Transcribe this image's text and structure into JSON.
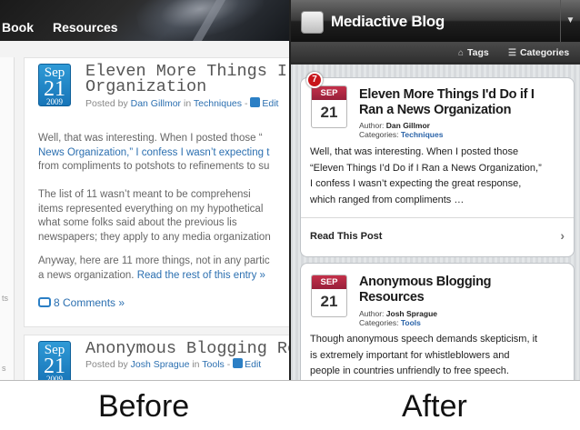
{
  "before": {
    "nav": [
      "Book",
      "Resources"
    ],
    "left_strip": [
      "ts",
      "s"
    ],
    "posts": [
      {
        "date": {
          "month": "Sep",
          "day": "21",
          "year": "2009"
        },
        "title_lines": [
          "Eleven More Things I’d Do",
          "Organization"
        ],
        "meta": {
          "prefix": "Posted by",
          "author": "Dan Gillmor",
          "in": "in",
          "category": "Techniques",
          "sep": "-",
          "edit": "Edit"
        },
        "paragraphs": [
          [
            "Well, that was interesting. When I posted those “",
            "News Organization,” I confess I wasn’t expecting t",
            "from compliments to potshots to refinements to su"
          ],
          [
            "The list of 11 wasn’t meant to be comprehensi",
            "items represented everything on my hypothetical",
            "what some folks said about the previous lis",
            "newspapers; they apply to any media organization"
          ],
          [
            "Anyway, here are 11 more things, not in any partic"
          ]
        ],
        "last_line": {
          "text": "a news organization.",
          "link": "Read the rest of this entry »"
        },
        "comments": "8 Comments »"
      },
      {
        "date": {
          "month": "Sep",
          "day": "21",
          "year": "2009"
        },
        "title_lines": [
          "Anonymous Blogging Reso"
        ],
        "meta": {
          "prefix": "Posted by",
          "author": "Josh Sprague",
          "in": "in",
          "category": "Tools",
          "sep": "-",
          "edit": "Edit"
        }
      }
    ]
  },
  "after": {
    "app_title": "Mediactive Blog",
    "subnav": {
      "tags": "Tags",
      "categories": "Categories"
    },
    "cards": [
      {
        "badge": "7",
        "date": {
          "month": "SEP",
          "day": "21"
        },
        "title_lines": [
          "Eleven More Things I'd Do if I",
          "Ran a News Organization"
        ],
        "author_label": "Author:",
        "author": "Dan Gillmor",
        "categories_label": "Categories:",
        "category": "Techniques",
        "excerpt": [
          "Well, that was interesting. When I posted those",
          "“Eleven Things I’d Do if I Ran a News Organization,”",
          "I confess I wasn’t expecting the great response,",
          "which ranged from compliments …"
        ],
        "read_label": "Read This Post"
      },
      {
        "date": {
          "month": "SEP",
          "day": "21"
        },
        "title_lines": [
          "Anonymous Blogging",
          "Resources"
        ],
        "author_label": "Author:",
        "author": "Josh Sprague",
        "categories_label": "Categories:",
        "category": "Tools",
        "excerpt": [
          "Though anonymous speech demands skepticism, it",
          "is extremely important for whistleblowers and",
          "people in countries unfriendly to free speech."
        ]
      }
    ]
  },
  "labels": {
    "before": "Before",
    "after": "After"
  }
}
